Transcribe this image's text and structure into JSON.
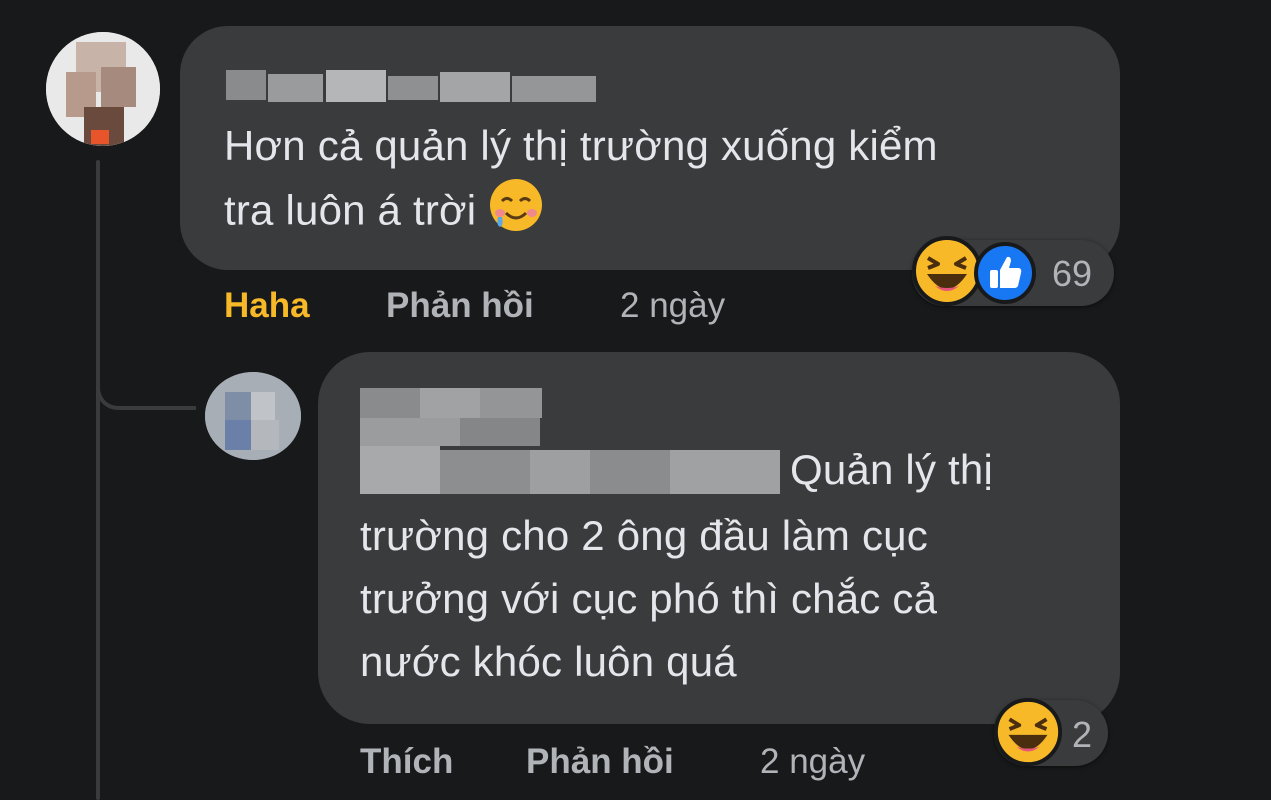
{
  "comments": [
    {
      "text_lines": [
        "Hơn cả quản lý thị trường xuống kiểm",
        "tra luôn á trời"
      ],
      "text_emoji": "crying-smile-emoji",
      "actions": {
        "react": "Haha",
        "reply": "Phản hồi",
        "time": "2 ngày"
      },
      "reactions": {
        "icons": [
          "haha-emoji",
          "like-icon"
        ],
        "count": "69"
      },
      "colors": {
        "react_active": "#f7b928"
      }
    },
    {
      "text_lines": [
        "Quản lý thị",
        "trường cho 2 ông đầu làm cục",
        "trưởng với cục phó thì chắc cả",
        "nước khóc luôn quá"
      ],
      "actions": {
        "react": "Thích",
        "reply": "Phản hồi",
        "time": "2 ngày"
      },
      "reactions": {
        "icons": [
          "haha-emoji"
        ],
        "count": "2"
      }
    }
  ],
  "colors": {
    "background": "#18191a",
    "bubble": "#3a3b3c",
    "text": "#e4e6eb",
    "muted": "#b0b3b8",
    "like_blue": "#1877f2"
  }
}
